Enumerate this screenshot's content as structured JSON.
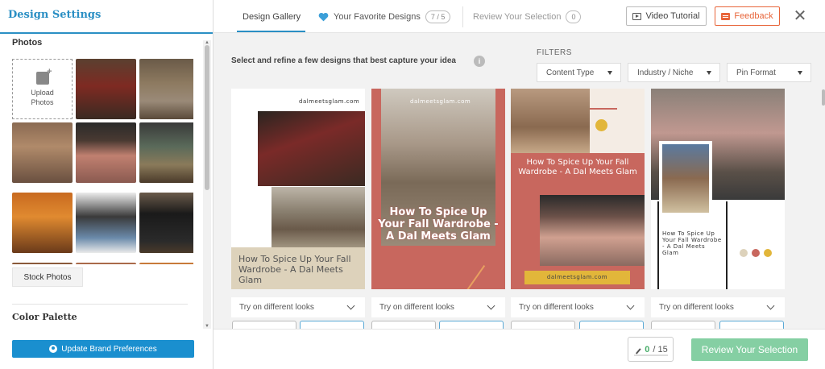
{
  "left_panel": {
    "title": "Design Settings",
    "photos_label": "Photos",
    "upload_label_1": "Upload",
    "upload_label_2": "Photos",
    "stock_photos_tab": "Stock Photos",
    "color_palette_label": "Color Palette",
    "update_button": "Update Brand Preferences"
  },
  "header": {
    "tabs": [
      {
        "label": "Design Gallery"
      },
      {
        "label": "Your Favorite Designs",
        "count": "7 / 5"
      },
      {
        "label": "Review Your Selection",
        "count": "0"
      }
    ],
    "video_button": "Video Tutorial",
    "feedback_button": "Feedback",
    "close_glyph": "✕"
  },
  "main": {
    "instruction": "Select and refine a few designs that best capture your idea",
    "info_glyph": "i",
    "filters_label": "FILTERS",
    "filters": [
      "Content Type",
      "Industry / Niche",
      "Pin Format"
    ],
    "cards": [
      {
        "site": "dalmeetsglam.com",
        "caption": "How To Spice Up Your Fall Wardrobe - A Dal Meets Glam",
        "look": "Try on different looks"
      },
      {
        "site": "dalmeetsglam.com",
        "caption": "How To Spice Up Your Fall Wardrobe - A Dal Meets Glam",
        "look": "Try on different looks"
      },
      {
        "site": "dalmeetsglam.com",
        "caption": "How To Spice Up Your Fall Wardrobe - A Dal Meets Glam",
        "look": "Try on different looks"
      },
      {
        "site": "",
        "caption": "How To Spice Up Your Fall Wardrobe - A Dal Meets Glam",
        "look": "Try on different looks"
      }
    ]
  },
  "footer": {
    "counter_value": "0",
    "counter_total": "/ 15",
    "review_button": "Review Your Selection"
  },
  "colors": {
    "brand_blue": "#2a8fc4",
    "update_button_blue": "#1a8fcf",
    "feedback_orange": "#e8653a",
    "review_green": "#85cfa3",
    "heart_blue": "#3b9fd8",
    "card_coral": "#c8675e",
    "card_beige": "#ddd2bb",
    "dot_gold": "#e2b63a"
  }
}
